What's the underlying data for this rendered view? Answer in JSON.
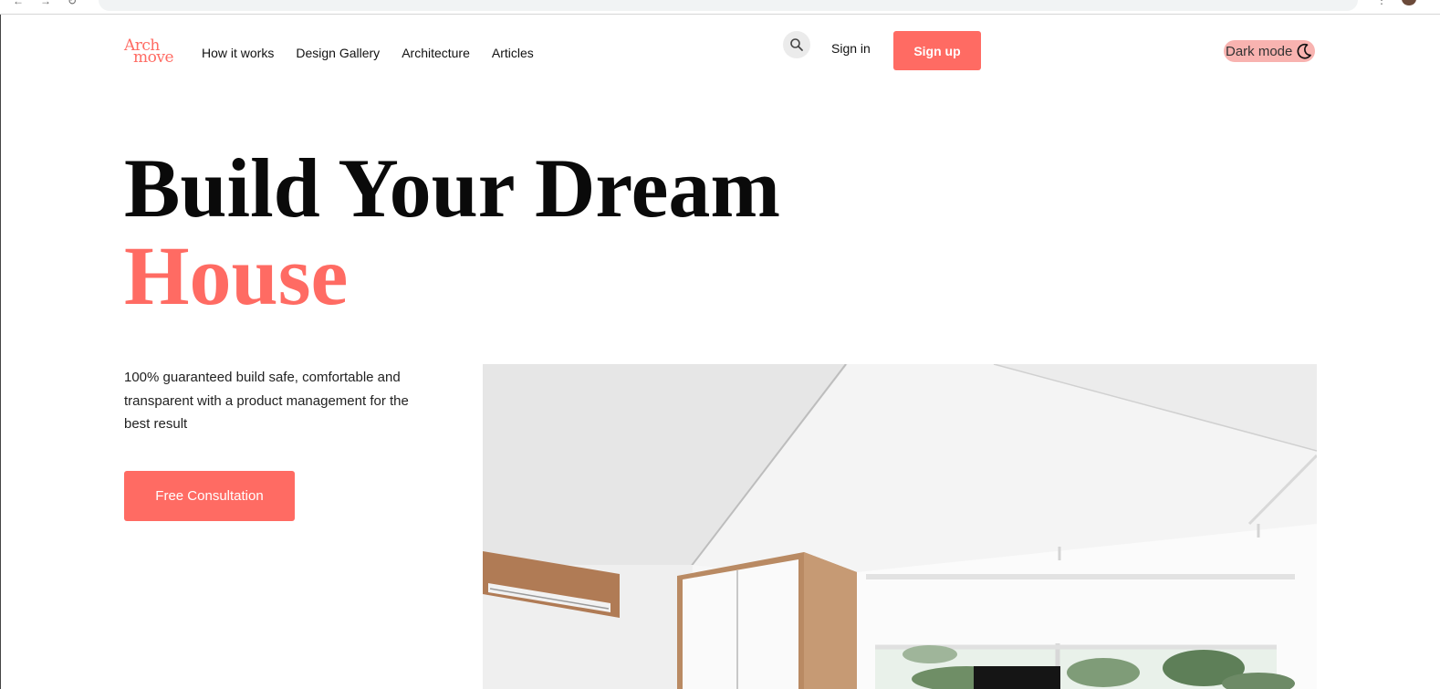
{
  "brand": {
    "logo_line1": "Arch",
    "logo_line2": "move"
  },
  "nav": {
    "items": [
      {
        "label": "How it works"
      },
      {
        "label": "Design Gallery"
      },
      {
        "label": "Architecture"
      },
      {
        "label": "Articles"
      }
    ]
  },
  "header": {
    "search_icon": "search-icon",
    "signin_label": "Sign in",
    "signup_label": "Sign up",
    "darkmode_label": "Dark mode",
    "darkmode_icon": "moon-icon"
  },
  "hero": {
    "title_line1": "Build Your Dream",
    "title_line2": "House",
    "description": "100% guaranteed build safe, comfortable and transparent with a product management for the best result",
    "cta_label": "Free Consultation"
  },
  "colors": {
    "accent": "#ff6b63",
    "accent_soft": "#f8b3b0",
    "text": "#0a0a0a"
  }
}
